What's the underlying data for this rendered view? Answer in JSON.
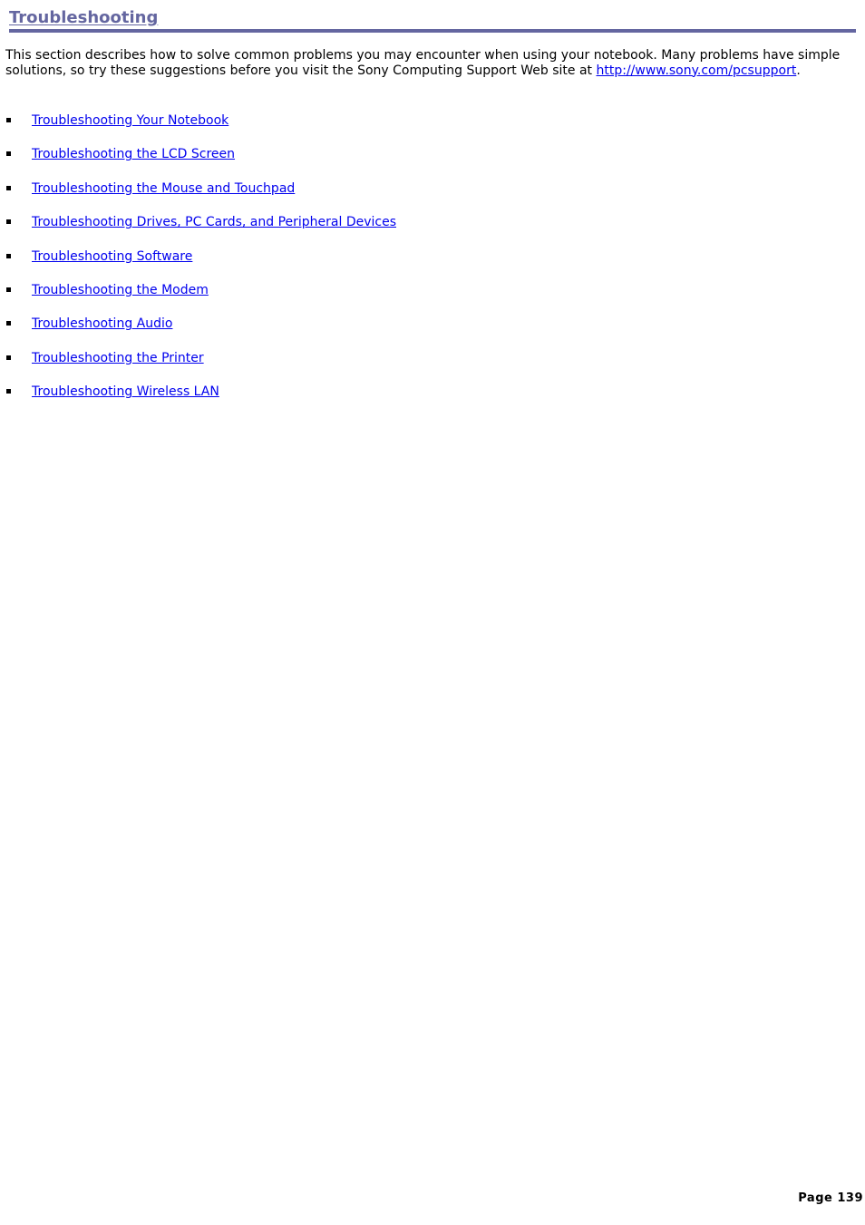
{
  "heading": {
    "title": "Troubleshooting",
    "color": "#6466a0"
  },
  "intro": {
    "text": "This section describes how to solve common problems you may encounter when using your notebook. Many problems have simple solutions, so try these suggestions before you visit the Sony Computing Support Web site at ",
    "link_text": "http://www.sony.com/pcsupport",
    "trailing": "."
  },
  "links": [
    {
      "label": "Troubleshooting Your Notebook"
    },
    {
      "label": "Troubleshooting the LCD Screen"
    },
    {
      "label": "Troubleshooting the Mouse and Touchpad"
    },
    {
      "label": "Troubleshooting Drives, PC Cards, and Peripheral Devices"
    },
    {
      "label": "Troubleshooting Software"
    },
    {
      "label": "Troubleshooting the Modem"
    },
    {
      "label": "Troubleshooting Audio"
    },
    {
      "label": "Troubleshooting the Printer"
    },
    {
      "label": "Troubleshooting Wireless LAN"
    }
  ],
  "link_color": "#0000ee",
  "footer": {
    "page_label": "Page 139"
  }
}
